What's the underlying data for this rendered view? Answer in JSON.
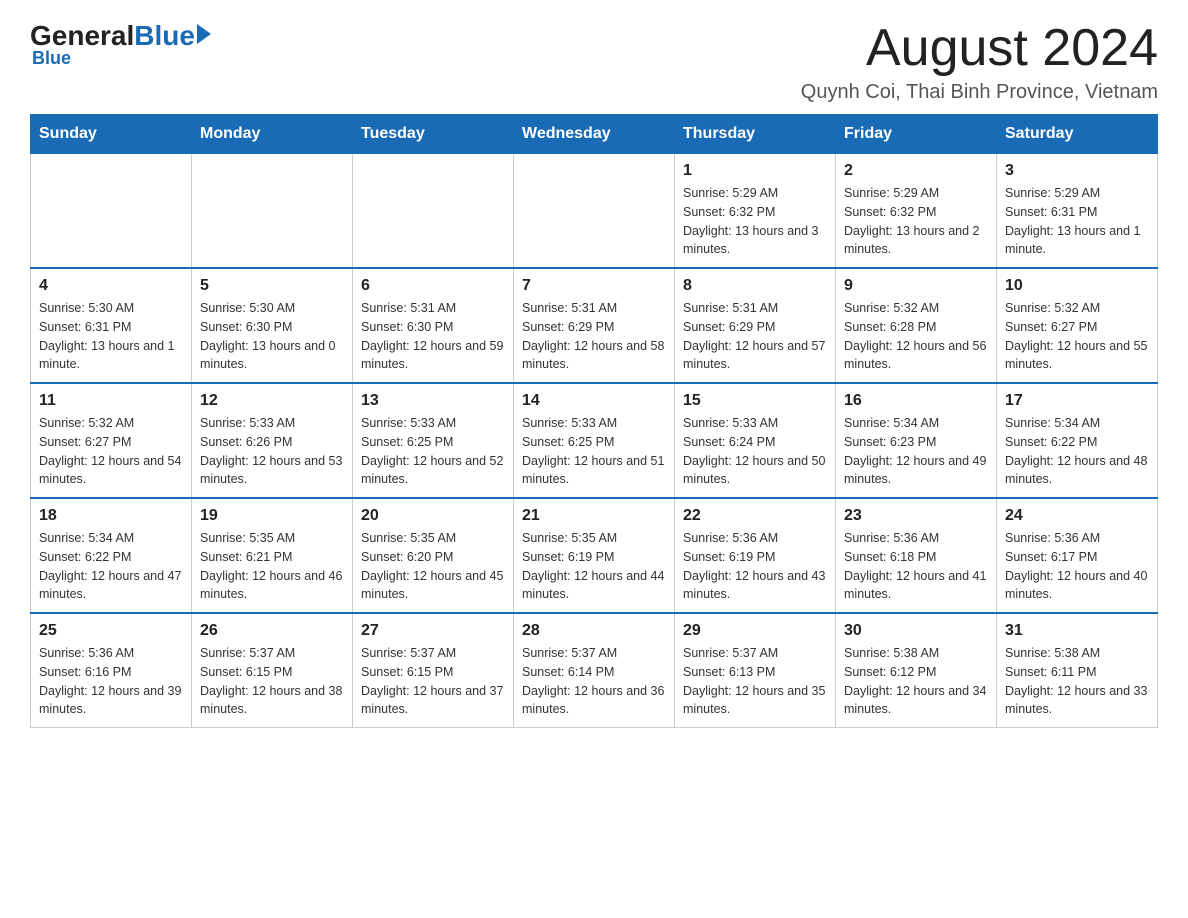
{
  "header": {
    "logo_general": "General",
    "logo_blue": "Blue",
    "title": "August 2024",
    "subtitle": "Quynh Coi, Thai Binh Province, Vietnam"
  },
  "calendar": {
    "days_of_week": [
      "Sunday",
      "Monday",
      "Tuesday",
      "Wednesday",
      "Thursday",
      "Friday",
      "Saturday"
    ],
    "weeks": [
      [
        {
          "day": "",
          "info": ""
        },
        {
          "day": "",
          "info": ""
        },
        {
          "day": "",
          "info": ""
        },
        {
          "day": "",
          "info": ""
        },
        {
          "day": "1",
          "info": "Sunrise: 5:29 AM\nSunset: 6:32 PM\nDaylight: 13 hours and 3 minutes."
        },
        {
          "day": "2",
          "info": "Sunrise: 5:29 AM\nSunset: 6:32 PM\nDaylight: 13 hours and 2 minutes."
        },
        {
          "day": "3",
          "info": "Sunrise: 5:29 AM\nSunset: 6:31 PM\nDaylight: 13 hours and 1 minute."
        }
      ],
      [
        {
          "day": "4",
          "info": "Sunrise: 5:30 AM\nSunset: 6:31 PM\nDaylight: 13 hours and 1 minute."
        },
        {
          "day": "5",
          "info": "Sunrise: 5:30 AM\nSunset: 6:30 PM\nDaylight: 13 hours and 0 minutes."
        },
        {
          "day": "6",
          "info": "Sunrise: 5:31 AM\nSunset: 6:30 PM\nDaylight: 12 hours and 59 minutes."
        },
        {
          "day": "7",
          "info": "Sunrise: 5:31 AM\nSunset: 6:29 PM\nDaylight: 12 hours and 58 minutes."
        },
        {
          "day": "8",
          "info": "Sunrise: 5:31 AM\nSunset: 6:29 PM\nDaylight: 12 hours and 57 minutes."
        },
        {
          "day": "9",
          "info": "Sunrise: 5:32 AM\nSunset: 6:28 PM\nDaylight: 12 hours and 56 minutes."
        },
        {
          "day": "10",
          "info": "Sunrise: 5:32 AM\nSunset: 6:27 PM\nDaylight: 12 hours and 55 minutes."
        }
      ],
      [
        {
          "day": "11",
          "info": "Sunrise: 5:32 AM\nSunset: 6:27 PM\nDaylight: 12 hours and 54 minutes."
        },
        {
          "day": "12",
          "info": "Sunrise: 5:33 AM\nSunset: 6:26 PM\nDaylight: 12 hours and 53 minutes."
        },
        {
          "day": "13",
          "info": "Sunrise: 5:33 AM\nSunset: 6:25 PM\nDaylight: 12 hours and 52 minutes."
        },
        {
          "day": "14",
          "info": "Sunrise: 5:33 AM\nSunset: 6:25 PM\nDaylight: 12 hours and 51 minutes."
        },
        {
          "day": "15",
          "info": "Sunrise: 5:33 AM\nSunset: 6:24 PM\nDaylight: 12 hours and 50 minutes."
        },
        {
          "day": "16",
          "info": "Sunrise: 5:34 AM\nSunset: 6:23 PM\nDaylight: 12 hours and 49 minutes."
        },
        {
          "day": "17",
          "info": "Sunrise: 5:34 AM\nSunset: 6:22 PM\nDaylight: 12 hours and 48 minutes."
        }
      ],
      [
        {
          "day": "18",
          "info": "Sunrise: 5:34 AM\nSunset: 6:22 PM\nDaylight: 12 hours and 47 minutes."
        },
        {
          "day": "19",
          "info": "Sunrise: 5:35 AM\nSunset: 6:21 PM\nDaylight: 12 hours and 46 minutes."
        },
        {
          "day": "20",
          "info": "Sunrise: 5:35 AM\nSunset: 6:20 PM\nDaylight: 12 hours and 45 minutes."
        },
        {
          "day": "21",
          "info": "Sunrise: 5:35 AM\nSunset: 6:19 PM\nDaylight: 12 hours and 44 minutes."
        },
        {
          "day": "22",
          "info": "Sunrise: 5:36 AM\nSunset: 6:19 PM\nDaylight: 12 hours and 43 minutes."
        },
        {
          "day": "23",
          "info": "Sunrise: 5:36 AM\nSunset: 6:18 PM\nDaylight: 12 hours and 41 minutes."
        },
        {
          "day": "24",
          "info": "Sunrise: 5:36 AM\nSunset: 6:17 PM\nDaylight: 12 hours and 40 minutes."
        }
      ],
      [
        {
          "day": "25",
          "info": "Sunrise: 5:36 AM\nSunset: 6:16 PM\nDaylight: 12 hours and 39 minutes."
        },
        {
          "day": "26",
          "info": "Sunrise: 5:37 AM\nSunset: 6:15 PM\nDaylight: 12 hours and 38 minutes."
        },
        {
          "day": "27",
          "info": "Sunrise: 5:37 AM\nSunset: 6:15 PM\nDaylight: 12 hours and 37 minutes."
        },
        {
          "day": "28",
          "info": "Sunrise: 5:37 AM\nSunset: 6:14 PM\nDaylight: 12 hours and 36 minutes."
        },
        {
          "day": "29",
          "info": "Sunrise: 5:37 AM\nSunset: 6:13 PM\nDaylight: 12 hours and 35 minutes."
        },
        {
          "day": "30",
          "info": "Sunrise: 5:38 AM\nSunset: 6:12 PM\nDaylight: 12 hours and 34 minutes."
        },
        {
          "day": "31",
          "info": "Sunrise: 5:38 AM\nSunset: 6:11 PM\nDaylight: 12 hours and 33 minutes."
        }
      ]
    ]
  }
}
